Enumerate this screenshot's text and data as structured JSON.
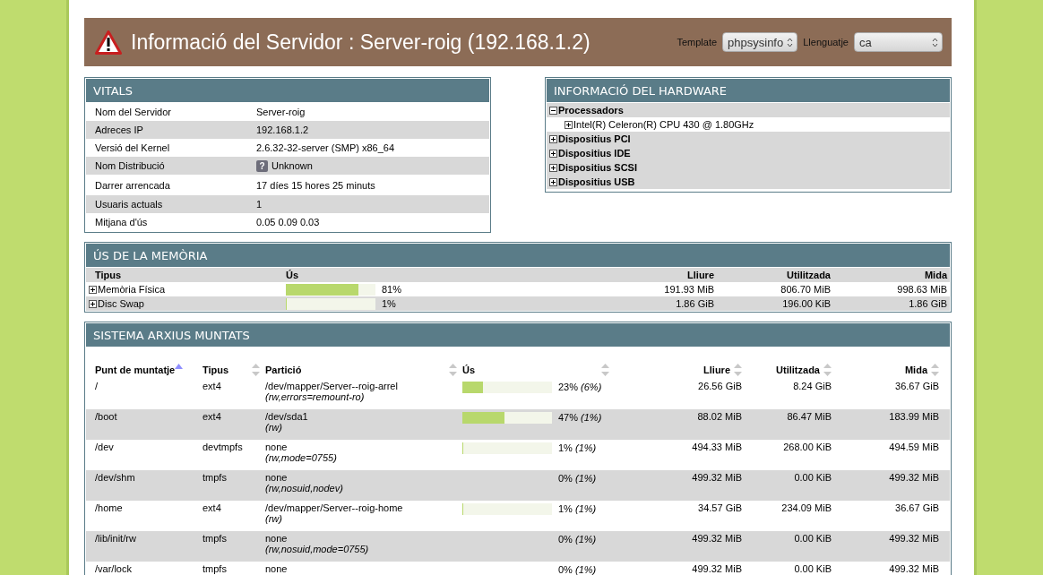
{
  "header": {
    "title": "Informació del Servidor : Server-roig (192.168.1.2)",
    "template_label": "Template",
    "template_value": "phpsysinfo",
    "language_label": "Llenguatje",
    "language_value": "ca"
  },
  "vitals": {
    "title": "VITALS",
    "rows": [
      {
        "label": "Nom del Servidor",
        "value": "Server-roig"
      },
      {
        "label": "Adreces IP",
        "value": "192.168.1.2"
      },
      {
        "label": "Versió del Kernel",
        "value": "2.6.32-32-server (SMP) x86_64"
      },
      {
        "label": "Nom Distribució",
        "value": "Unknown",
        "badge": "?"
      },
      {
        "label": "Darrer arrencada",
        "value": "17 díes 15 hores 25 minuts"
      },
      {
        "label": "Usuaris actuals",
        "value": "1"
      },
      {
        "label": "Mitjana d'ús",
        "value": "0.05 0.09 0.03"
      }
    ]
  },
  "hardware": {
    "title": "INFORMACIÓ DEL HARDWARE",
    "items": [
      {
        "label": "Processadors",
        "expanded": true,
        "children": [
          {
            "label": "Intel(R) Celeron(R) CPU 430 @ 1.80GHz",
            "expanded": false
          }
        ]
      },
      {
        "label": "Dispositius PCI",
        "expanded": false
      },
      {
        "label": "Dispositius IDE",
        "expanded": false
      },
      {
        "label": "Dispositius SCSI",
        "expanded": false
      },
      {
        "label": "Dispositius USB",
        "expanded": false
      }
    ]
  },
  "memory": {
    "title": "ÚS DE LA MEMÒRIA",
    "columns": [
      "Tipus",
      "Ús",
      "Lliure",
      "Utilitzada",
      "Mida"
    ],
    "rows": [
      {
        "type": "Memòria Física",
        "expanded": false,
        "level": 0.81,
        "usage": "81%",
        "free": "191.93 MiB",
        "used": "806.70 MiB",
        "size": "998.63 MiB"
      },
      {
        "type": "Disc Swap",
        "expanded": false,
        "level": 0.01,
        "usage": "1%",
        "free": "1.86 GiB",
        "used": "196.00 KiB",
        "size": "1.86 GiB"
      }
    ]
  },
  "filesystems": {
    "title": "SISTEMA ARXIUS MUNTATS",
    "columns": [
      {
        "label": "Punt de muntatje",
        "sorted": true
      },
      {
        "label": "Tipus",
        "sorted": false
      },
      {
        "label": "Partició",
        "sorted": false
      },
      {
        "label": "Ús",
        "sorted": false
      },
      {
        "label": "Lliure",
        "sorted": false
      },
      {
        "label": "Utilitzada",
        "sorted": false
      },
      {
        "label": "Mida",
        "sorted": false
      }
    ],
    "rows": [
      {
        "mount": "/",
        "type": "ext4",
        "partition": "/dev/mapper/Server--roig-arrel",
        "options": "(rw,errors=remount-ro)",
        "level": 0.23,
        "usage": "23%",
        "inodes": "(6%)",
        "free": "26.56 GiB",
        "used": "8.24 GiB",
        "size": "36.67 GiB"
      },
      {
        "mount": "/boot",
        "type": "ext4",
        "partition": "/dev/sda1",
        "options": "(rw)",
        "level": 0.47,
        "usage": "47%",
        "inodes": "(1%)",
        "free": "88.02 MiB",
        "used": "86.47 MiB",
        "size": "183.99 MiB"
      },
      {
        "mount": "/dev",
        "type": "devtmpfs",
        "partition": "none",
        "options": "(rw,mode=0755)",
        "level": 0.01,
        "usage": "1%",
        "inodes": "(1%)",
        "free": "494.33 MiB",
        "used": "268.00 KiB",
        "size": "494.59 MiB"
      },
      {
        "mount": "/dev/shm",
        "type": "tmpfs",
        "partition": "none",
        "options": "(rw,nosuid,nodev)",
        "usage": "0%",
        "inodes": "(1%)",
        "free": "499.32 MiB",
        "used": "0.00 KiB",
        "size": "499.32 MiB"
      },
      {
        "mount": "/home",
        "type": "ext4",
        "partition": "/dev/mapper/Server--roig-home",
        "options": "(rw)",
        "level": 0.01,
        "usage": "1%",
        "inodes": "(1%)",
        "free": "34.57 GiB",
        "used": "234.09 MiB",
        "size": "36.67 GiB"
      },
      {
        "mount": "/lib/init/rw",
        "type": "tmpfs",
        "partition": "none",
        "options": "(rw,nosuid,mode=0755)",
        "usage": "0%",
        "inodes": "(1%)",
        "free": "499.32 MiB",
        "used": "0.00 KiB",
        "size": "499.32 MiB"
      },
      {
        "mount": "/var/lock",
        "type": "tmpfs",
        "partition": "none",
        "usage": "0%",
        "inodes": "(1%)",
        "free": "499.32 MiB",
        "used": "0.00 KiB",
        "size": "499.32 MiB"
      }
    ]
  }
}
